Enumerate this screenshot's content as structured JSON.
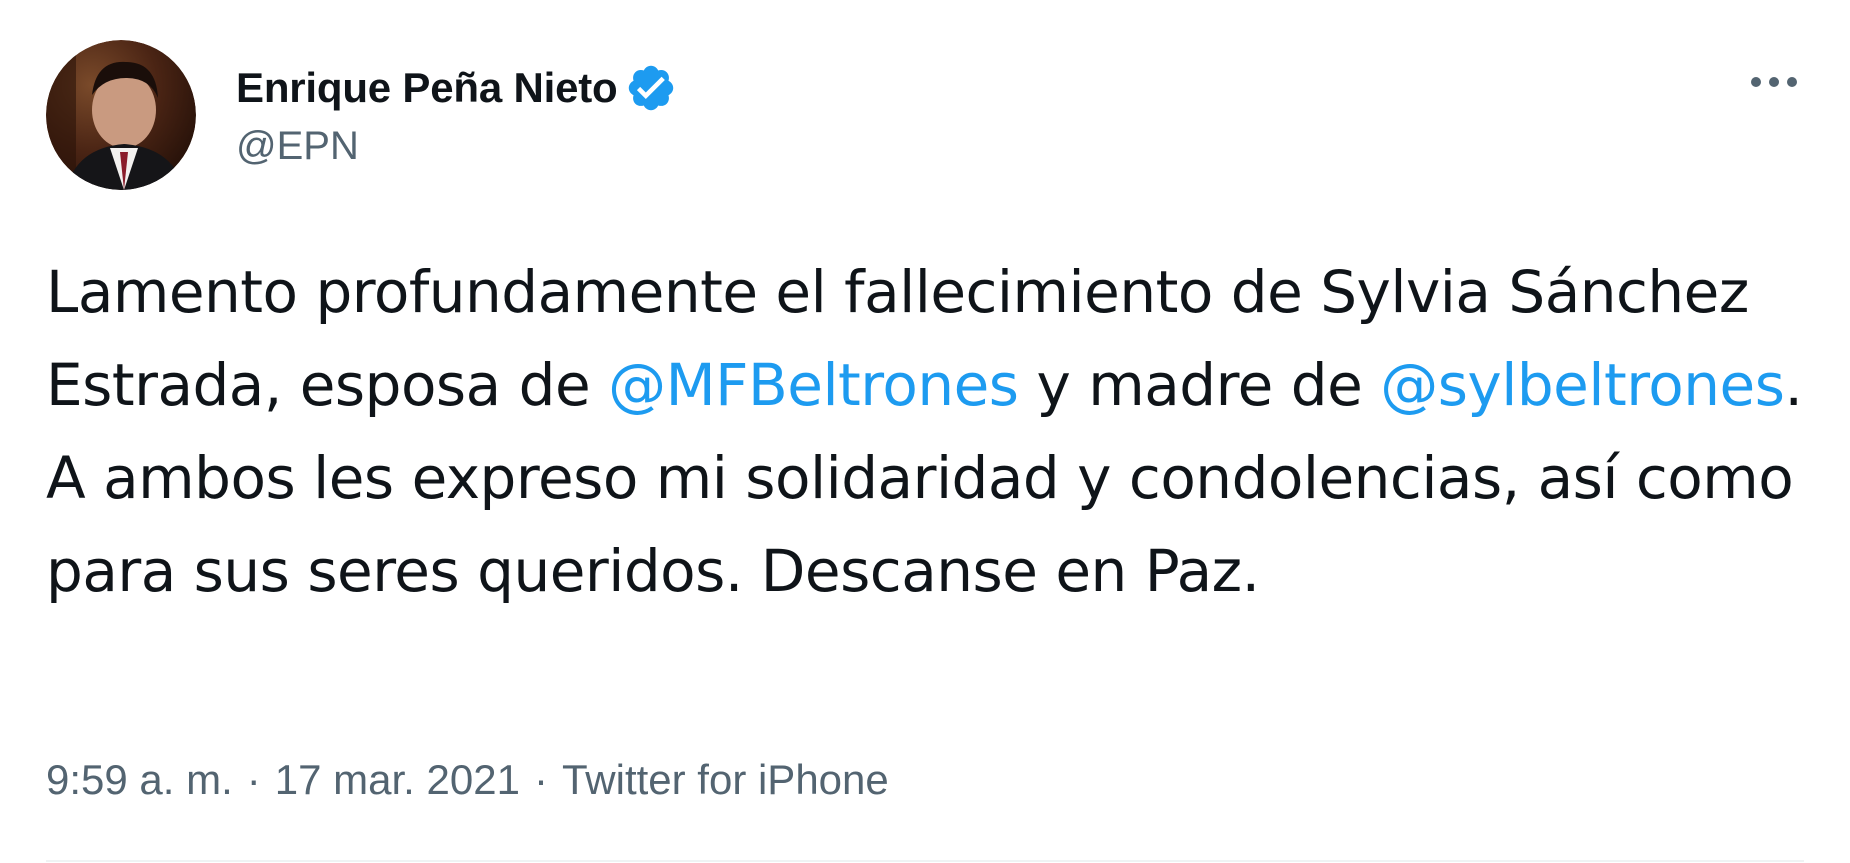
{
  "author": {
    "display_name": "Enrique Peña Nieto",
    "handle": "@EPN",
    "avatar_icon": "profile-photo",
    "verified_icon": "verified-badge-icon",
    "verified_color": "#1d9bf0"
  },
  "tweet": {
    "segments": [
      {
        "text": "Lamento profundamente el fallecimiento de Sylvia Sánchez Estrada, esposa de ",
        "type": "text"
      },
      {
        "text": "@MFBeltrones",
        "type": "mention"
      },
      {
        "text": " y madre de ",
        "type": "text"
      },
      {
        "text": "@sylbeltrones",
        "type": "mention"
      },
      {
        "text": ". A ambos les expreso mi solidaridad y condolencias, así como para sus seres queridos. Descanse en Paz.",
        "type": "text"
      }
    ]
  },
  "meta": {
    "time": "9:59 a. m.",
    "separator": "·",
    "date": "17 mar. 2021",
    "source": "Twitter for iPhone"
  },
  "more_icon": "more-options-icon",
  "colors": {
    "text": "#0f1419",
    "secondary": "#536471",
    "accent": "#1d9bf0"
  }
}
